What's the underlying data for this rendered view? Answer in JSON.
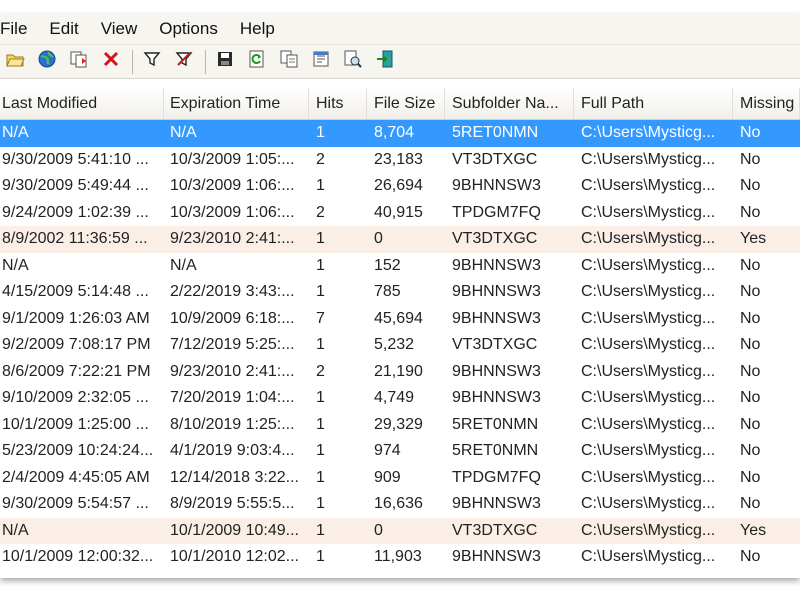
{
  "menu": [
    "File",
    "Edit",
    "View",
    "Options",
    "Help"
  ],
  "toolbar": [
    {
      "name": "open-folder-icon"
    },
    {
      "name": "globe-icon"
    },
    {
      "name": "copy-files-icon"
    },
    {
      "name": "delete-icon"
    },
    {
      "sep": true
    },
    {
      "name": "filter-icon"
    },
    {
      "name": "filter-off-icon"
    },
    {
      "sep": true
    },
    {
      "name": "save-icon"
    },
    {
      "name": "refresh-icon"
    },
    {
      "name": "copy-icon"
    },
    {
      "name": "properties-icon"
    },
    {
      "name": "find-icon"
    },
    {
      "name": "exit-icon"
    }
  ],
  "columns": [
    "Last Modified",
    "Expiration Time",
    "Hits",
    "File Size",
    "Subfolder Na...",
    "Full Path",
    "Missing"
  ],
  "rows": [
    [
      "N/A",
      "N/A",
      "1",
      "8,704",
      "5RET0NMN",
      "C:\\Users\\Mysticg...",
      "No"
    ],
    [
      "9/30/2009 5:41:10 ...",
      "10/3/2009 1:05:...",
      "2",
      "23,183",
      "VT3DTXGC",
      "C:\\Users\\Mysticg...",
      "No"
    ],
    [
      "9/30/2009 5:49:44 ...",
      "10/3/2009 1:06:...",
      "1",
      "26,694",
      "9BHNNSW3",
      "C:\\Users\\Mysticg...",
      "No"
    ],
    [
      "9/24/2009 1:02:39 ...",
      "10/3/2009 1:06:...",
      "2",
      "40,915",
      "TPDGM7FQ",
      "C:\\Users\\Mysticg...",
      "No"
    ],
    [
      "8/9/2002 11:36:59 ...",
      "9/23/2010 2:41:...",
      "1",
      "0",
      "VT3DTXGC",
      "C:\\Users\\Mysticg...",
      "Yes"
    ],
    [
      "N/A",
      "N/A",
      "1",
      "152",
      "9BHNNSW3",
      "C:\\Users\\Mysticg...",
      "No"
    ],
    [
      "4/15/2009 5:14:48 ...",
      "2/22/2019 3:43:...",
      "1",
      "785",
      "9BHNNSW3",
      "C:\\Users\\Mysticg...",
      "No"
    ],
    [
      "9/1/2009 1:26:03 AM",
      "10/9/2009 6:18:...",
      "7",
      "45,694",
      "9BHNNSW3",
      "C:\\Users\\Mysticg...",
      "No"
    ],
    [
      "9/2/2009 7:08:17 PM",
      "7/12/2019 5:25:...",
      "1",
      "5,232",
      "VT3DTXGC",
      "C:\\Users\\Mysticg...",
      "No"
    ],
    [
      "8/6/2009 7:22:21 PM",
      "9/23/2010 2:41:...",
      "2",
      "21,190",
      "9BHNNSW3",
      "C:\\Users\\Mysticg...",
      "No"
    ],
    [
      "9/10/2009 2:32:05 ...",
      "7/20/2019 1:04:...",
      "1",
      "4,749",
      "9BHNNSW3",
      "C:\\Users\\Mysticg...",
      "No"
    ],
    [
      "10/1/2009 1:25:00 ...",
      "8/10/2019 1:25:...",
      "1",
      "29,329",
      "5RET0NMN",
      "C:\\Users\\Mysticg...",
      "No"
    ],
    [
      "5/23/2009 10:24:24...",
      "4/1/2019 9:03:4...",
      "1",
      "974",
      "5RET0NMN",
      "C:\\Users\\Mysticg...",
      "No"
    ],
    [
      "2/4/2009 4:45:05 AM",
      "12/14/2018 3:22...",
      "1",
      "909",
      "TPDGM7FQ",
      "C:\\Users\\Mysticg...",
      "No"
    ],
    [
      "9/30/2009 5:54:57 ...",
      "8/9/2019 5:55:5...",
      "1",
      "16,636",
      "9BHNNSW3",
      "C:\\Users\\Mysticg...",
      "No"
    ],
    [
      "N/A",
      "10/1/2009 10:49...",
      "1",
      "0",
      "VT3DTXGC",
      "C:\\Users\\Mysticg...",
      "Yes"
    ],
    [
      "10/1/2009 12:00:32...",
      "10/1/2010 12:02...",
      "1",
      "11,903",
      "9BHNNSW3",
      "C:\\Users\\Mysticg...",
      "No"
    ]
  ],
  "selected_row": 0,
  "colors": {
    "selection": "#3399ff",
    "missing_row": "#fbeee6"
  }
}
